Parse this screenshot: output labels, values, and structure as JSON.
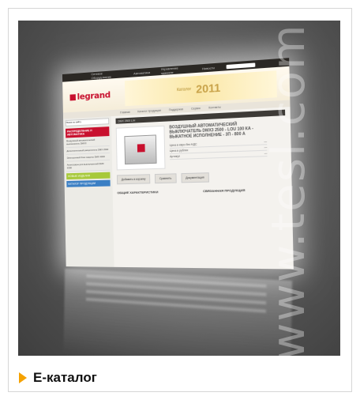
{
  "watermark": "www.tesl.com",
  "caption": {
    "label": "E-каталог"
  },
  "screen": {
    "topbar": [
      "Сетевое Оборудование",
      "Автоматика",
      "Управление зданием",
      "Новости"
    ],
    "logo": "legrand",
    "banner": {
      "text": "Каталог",
      "year": "2011"
    },
    "nav": [
      "Главная",
      "Каталог продукции",
      "Поддержка",
      "Сервис",
      "Контакты"
    ],
    "sidebar": {
      "search": "Поиск по сайту",
      "head": "РАСПРЕДЕЛЕНИЕ И АВТОМАТИКА",
      "items": [
        "Воздушный автоматический выключатель DMX3",
        "Дополнительный расцепитель DMX 2500",
        "Электронный блок защиты DMX 4000",
        "Аксессуары для выключателей DMX 6300"
      ],
      "green": "НОВЫЕ ИЗДЕЛИЯ",
      "blue": "КАТАЛОГ ПРОДУКЦИИ"
    },
    "main": {
      "bar": "DMX 2500 L/H",
      "title": "ВОЗДУШНЫЙ АВТОМАТИЧЕСКИЙ ВЫКЛЮЧАТЕЛЬ DMX3 2500 - LOU 100 КА - ВЫКАТНОЕ ИСПОЛНЕНИЕ - 3П - 800 А",
      "prices": [
        {
          "k": "Цена в евро без НДС",
          "v": "—"
        },
        {
          "k": "Цена в рублях",
          "v": "—"
        },
        {
          "k": "Артикул",
          "v": "—"
        }
      ],
      "actions": [
        "Добавить в корзину",
        "Сравнить",
        "Документация"
      ],
      "specs_left_title": "ОБЩИЕ ХАРАКТЕРИСТИКИ",
      "specs_right_title": "СВЯЗАННАЯ ПРОДУКЦИЯ"
    }
  }
}
